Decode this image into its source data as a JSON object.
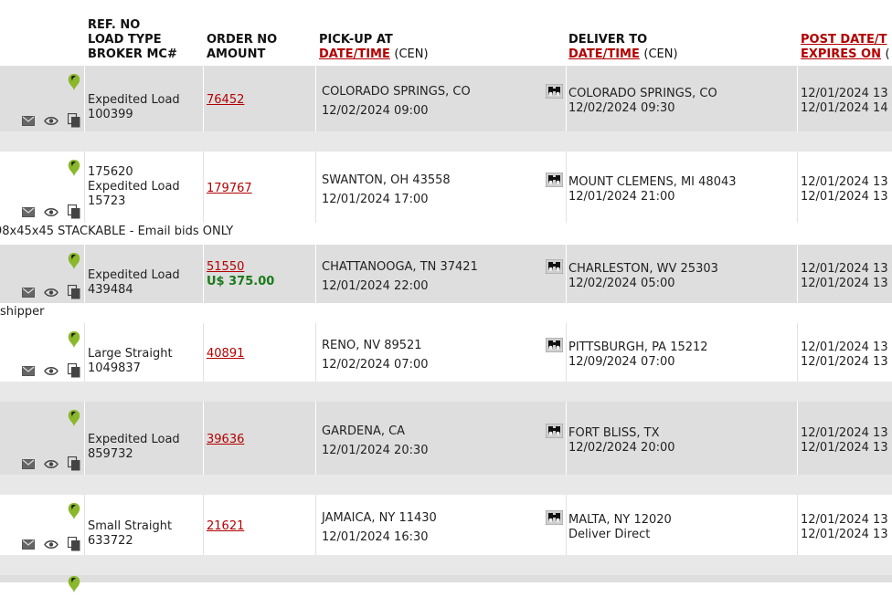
{
  "header": {
    "col_ref": [
      "REF. NO",
      "LOAD TYPE",
      "BROKER MC#"
    ],
    "col_order": [
      "ORDER NO",
      "AMOUNT"
    ],
    "col_pickup": {
      "title": "PICK-UP AT",
      "link": "DATE/TIME",
      "tz": "(CEN)"
    },
    "col_deliver": {
      "title": "DELIVER TO",
      "link": "DATE/TIME",
      "tz": "(CEN)"
    },
    "col_post": {
      "link1": "POST DATE/T",
      "link2": "EXPIRES ON",
      "tail": "("
    }
  },
  "rows": [
    {
      "ref": "",
      "load_type": "Expedited Load",
      "broker_mc": "100399",
      "order_no": "76452",
      "amount": "",
      "pickup_place": "COLORADO SPRINGS, CO",
      "pickup_time": "12/02/2024 09:00",
      "deliver_place": "COLORADO SPRINGS, CO",
      "deliver_time": "12/02/2024 09:30",
      "post_date": "12/01/2024 13",
      "expires_on": "12/01/2024 14",
      "note": ""
    },
    {
      "ref": "175620",
      "load_type": "Expedited Load",
      "broker_mc": "15723",
      "order_no": "179767",
      "amount": "",
      "pickup_place": "SWANTON, OH 43558",
      "pickup_time": "12/01/2024 17:00",
      "deliver_place": "MOUNT CLEMENS, MI 48043",
      "deliver_time": "12/01/2024 21:00",
      "post_date": "12/01/2024 13",
      "expires_on": "12/01/2024 13",
      "note": "98x45x45 STACKABLE - Email bids ONLY"
    },
    {
      "ref": "",
      "load_type": "Expedited Load",
      "broker_mc": "439484",
      "order_no": "51550",
      "amount": "U$ 375.00",
      "pickup_place": "CHATTANOOGA, TN 37421",
      "pickup_time": "12/01/2024 22:00",
      "deliver_place": "CHARLESTON, WV 25303",
      "deliver_time": "12/02/2024 05:00",
      "post_date": "12/01/2024 13",
      "expires_on": "12/01/2024 13",
      "note": "shipper"
    },
    {
      "ref": "",
      "load_type": "Large Straight",
      "broker_mc": "1049837",
      "order_no": "40891",
      "amount": "",
      "pickup_place": "RENO, NV 89521",
      "pickup_time": "12/02/2024 07:00",
      "deliver_place": "PITTSBURGH, PA 15212",
      "deliver_time": "12/09/2024 07:00",
      "post_date": "12/01/2024 13",
      "expires_on": "12/01/2024 13",
      "note": ""
    },
    {
      "ref": "",
      "load_type": "Expedited Load",
      "broker_mc": "859732",
      "order_no": "39636",
      "amount": "",
      "pickup_place": "GARDENA, CA",
      "pickup_time": "12/01/2024 20:30",
      "deliver_place": "FORT BLISS, TX",
      "deliver_time": "12/02/2024 20:00",
      "post_date": "12/01/2024 13",
      "expires_on": "12/01/2024 13",
      "note": ""
    },
    {
      "ref": "",
      "load_type": "Small Straight",
      "broker_mc": "633722",
      "order_no": "21621",
      "amount": "",
      "pickup_place": "JAMAICA, NY 11430",
      "pickup_time": "12/01/2024 16:30",
      "deliver_place": "MALTA, NY 12020",
      "deliver_time": "Deliver Direct",
      "post_date": "12/01/2024 13",
      "expires_on": "12/01/2024 13",
      "note": ""
    }
  ],
  "icons": {
    "pin": "map-pin-icon",
    "email": "email-icon",
    "view": "eye-icon",
    "copy": "copy-icon",
    "map": "binoculars-icon"
  },
  "colors": {
    "link": "#b30000",
    "amount": "#1a7a1a",
    "pin": "#8ab82a",
    "row_gray": "#dedede"
  }
}
